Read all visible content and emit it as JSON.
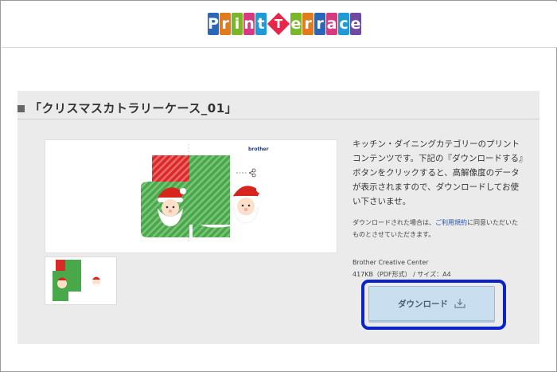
{
  "logo": {
    "letters_left": [
      "P",
      "r",
      "i",
      "n",
      "t"
    ],
    "diamond_letter": "T",
    "letters_right": [
      "e",
      "r",
      "r",
      "a",
      "c",
      "e"
    ],
    "colors_left": [
      "#2a67b8",
      "#e07b1e",
      "#7bb528",
      "#d63a81",
      "#1e9bd7"
    ],
    "colors_right": [
      "#79b82a",
      "#e07b1e",
      "#2a67b8",
      "#d63a81",
      "#1e9bd7",
      "#6e4aa0"
    ]
  },
  "product": {
    "title": "「クリスマスカトラリーケース_01」",
    "description": "キッチン・ダイニングカテゴリーのプリントコンテンツです。下記の『ダウンロードする』ボタンをクリックすると、高解像度のデータが表示されますので、ダウンロードしてお使い下さいませ。",
    "note_before_link": "ダウンロードされた場合は、",
    "note_link": "ご利用規約",
    "note_after_link": "に同意いただいたものとさせていただきます。",
    "provider": "Brother Creative Center",
    "file_info": "417KB（PDF形式） / サイズ：A4",
    "brand_label": "brother"
  },
  "download": {
    "label": "ダウンロード",
    "icon": "download-icon"
  },
  "colors": {
    "highlight": "#0b24c9",
    "button_bg": "#c9dff0",
    "panel_bg": "#ebebeb"
  }
}
